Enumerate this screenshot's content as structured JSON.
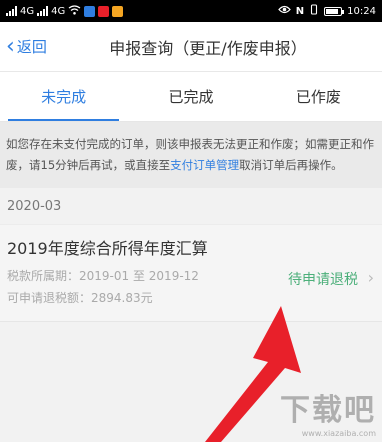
{
  "status_bar": {
    "left_icons": [
      "sim1-signal-icon",
      "sim2-signal-icon",
      "wifi-icon",
      "app-icons"
    ],
    "signal_labels": [
      "4G",
      "4G"
    ],
    "time": "10:24"
  },
  "nav": {
    "back_label": "返回",
    "title": "申报查询（更正/作废申报）"
  },
  "tabs": [
    {
      "label": "未完成",
      "active": true
    },
    {
      "label": "已完成",
      "active": false
    },
    {
      "label": "已作废",
      "active": false
    }
  ],
  "notice": {
    "text_before": "如您存在未支付完成的订单，则该申报表无法更正和作废；如需更正和作废，请15分钟后再试，或直接至",
    "link": "支付订单管理",
    "text_after": "取消订单后再操作。"
  },
  "section": {
    "label": "2020-03"
  },
  "record": {
    "title": "2019年度综合所得年度汇算",
    "period_label": "税款所属期：",
    "period_value": "2019-01 至 2019-12",
    "refund_label": "可申请退税额：",
    "refund_value": "2894.83元",
    "status": "待申请退税"
  },
  "watermark": {
    "text": "下载吧",
    "sub": "www.xiazaiba.com"
  },
  "colors": {
    "accent": "#2f7ee0",
    "status_green": "#4caf7a",
    "arrow_red": "#e8202a"
  }
}
